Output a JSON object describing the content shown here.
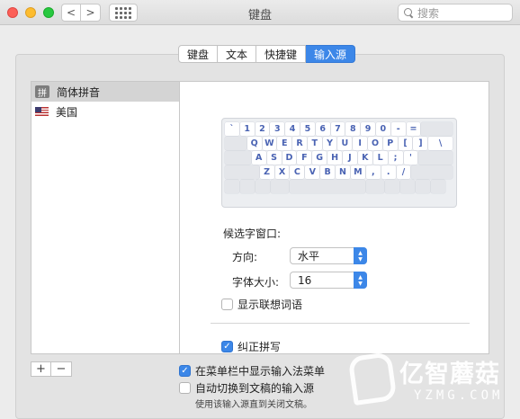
{
  "window": {
    "title": "键盘"
  },
  "toolbar": {
    "nav_back": "<",
    "nav_forward": ">",
    "search_placeholder": "搜索"
  },
  "tabs": [
    {
      "label": "键盘",
      "active": false
    },
    {
      "label": "文本",
      "active": false
    },
    {
      "label": "快捷键",
      "active": false
    },
    {
      "label": "输入源",
      "active": true
    }
  ],
  "sources": [
    {
      "label": "简体拼音",
      "icon_char": "拼",
      "icon": "pinyin-icon",
      "selected": true
    },
    {
      "label": "美国",
      "icon": "us-flag-icon",
      "selected": false
    }
  ],
  "keyboard": {
    "rows": [
      [
        "`",
        "1",
        "2",
        "3",
        "4",
        "5",
        "6",
        "7",
        "8",
        "9",
        "0",
        "-",
        "="
      ],
      [
        "",
        "Q",
        "W",
        "E",
        "R",
        "T",
        "Y",
        "U",
        "I",
        "O",
        "P",
        "[",
        "]",
        "\\"
      ],
      [
        "",
        "A",
        "S",
        "D",
        "F",
        "G",
        "H",
        "J",
        "K",
        "L",
        ";",
        "'"
      ],
      [
        "",
        "Z",
        "X",
        "C",
        "V",
        "B",
        "N",
        "M",
        ",",
        ".",
        "/"
      ]
    ]
  },
  "candidate": {
    "section_label": "候选字窗口:",
    "direction_label": "方向:",
    "direction_value": "水平",
    "font_size_label": "字体大小:",
    "font_size_value": "16"
  },
  "options": {
    "show_suggestions": {
      "label": "显示联想词语",
      "checked": false
    },
    "spell_correction": {
      "label": "纠正拼写",
      "checked": true
    }
  },
  "list_controls": {
    "add": "+",
    "remove": "−"
  },
  "bottom": {
    "show_menu": {
      "label": "在菜单栏中显示输入法菜单",
      "checked": true
    },
    "auto_switch": {
      "label": "自动切换到文稿的输入源",
      "checked": false
    },
    "hint": "使用该输入源直到关闭文稿。"
  },
  "watermark": {
    "brand": "亿智蘑菇",
    "domain": "YZMG.COM"
  },
  "colors": {
    "accent": "#3c87e8",
    "key_text": "#4a63b3"
  }
}
